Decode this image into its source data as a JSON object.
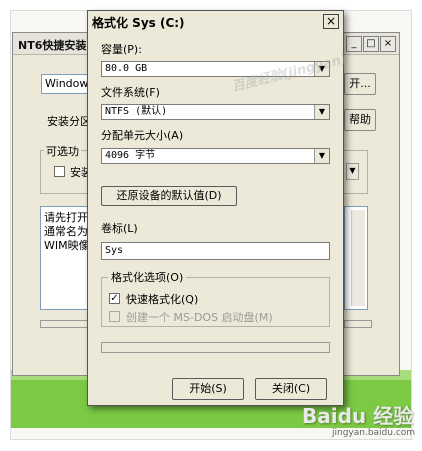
{
  "background_window": {
    "title": "NT6快捷安装",
    "window_field_text": "Windows",
    "browse_button": "开...",
    "install_partition_label": "安装分区",
    "help_button": "帮助",
    "optional_label": "可选功",
    "install_checkbox_label": "安装",
    "info_lines": [
      "请先打开",
      "通常名为",
      "WIM映像"
    ]
  },
  "dialog": {
    "title": "格式化 Sys (C:)",
    "capacity_label": "容量(P):",
    "capacity_value": "80.0 GB",
    "filesystem_label": "文件系统(F)",
    "filesystem_value": "NTFS (默认)",
    "allocation_label": "分配单元大小(A)",
    "allocation_value": "4096 字节",
    "restore_button": "还原设备的默认值(D)",
    "volume_label_label": "卷标(L)",
    "volume_label_value": "Sys",
    "format_options_label": "格式化选项(O)",
    "quick_format_label": "快速格式化(Q)",
    "quick_format_checked": true,
    "msdos_label": "创建一个 MS-DOS 启动盘(M)",
    "msdos_checked": false,
    "start_button": "开始(S)",
    "close_button": "关闭(C)"
  },
  "watermark": {
    "text": "百度经验(jingyan)",
    "brand": "Baidu 经验",
    "url": "jingyan.baidu.com"
  },
  "colors": {
    "dialog_bg": "#ece9d8",
    "desktop_green": "#7cc944"
  }
}
